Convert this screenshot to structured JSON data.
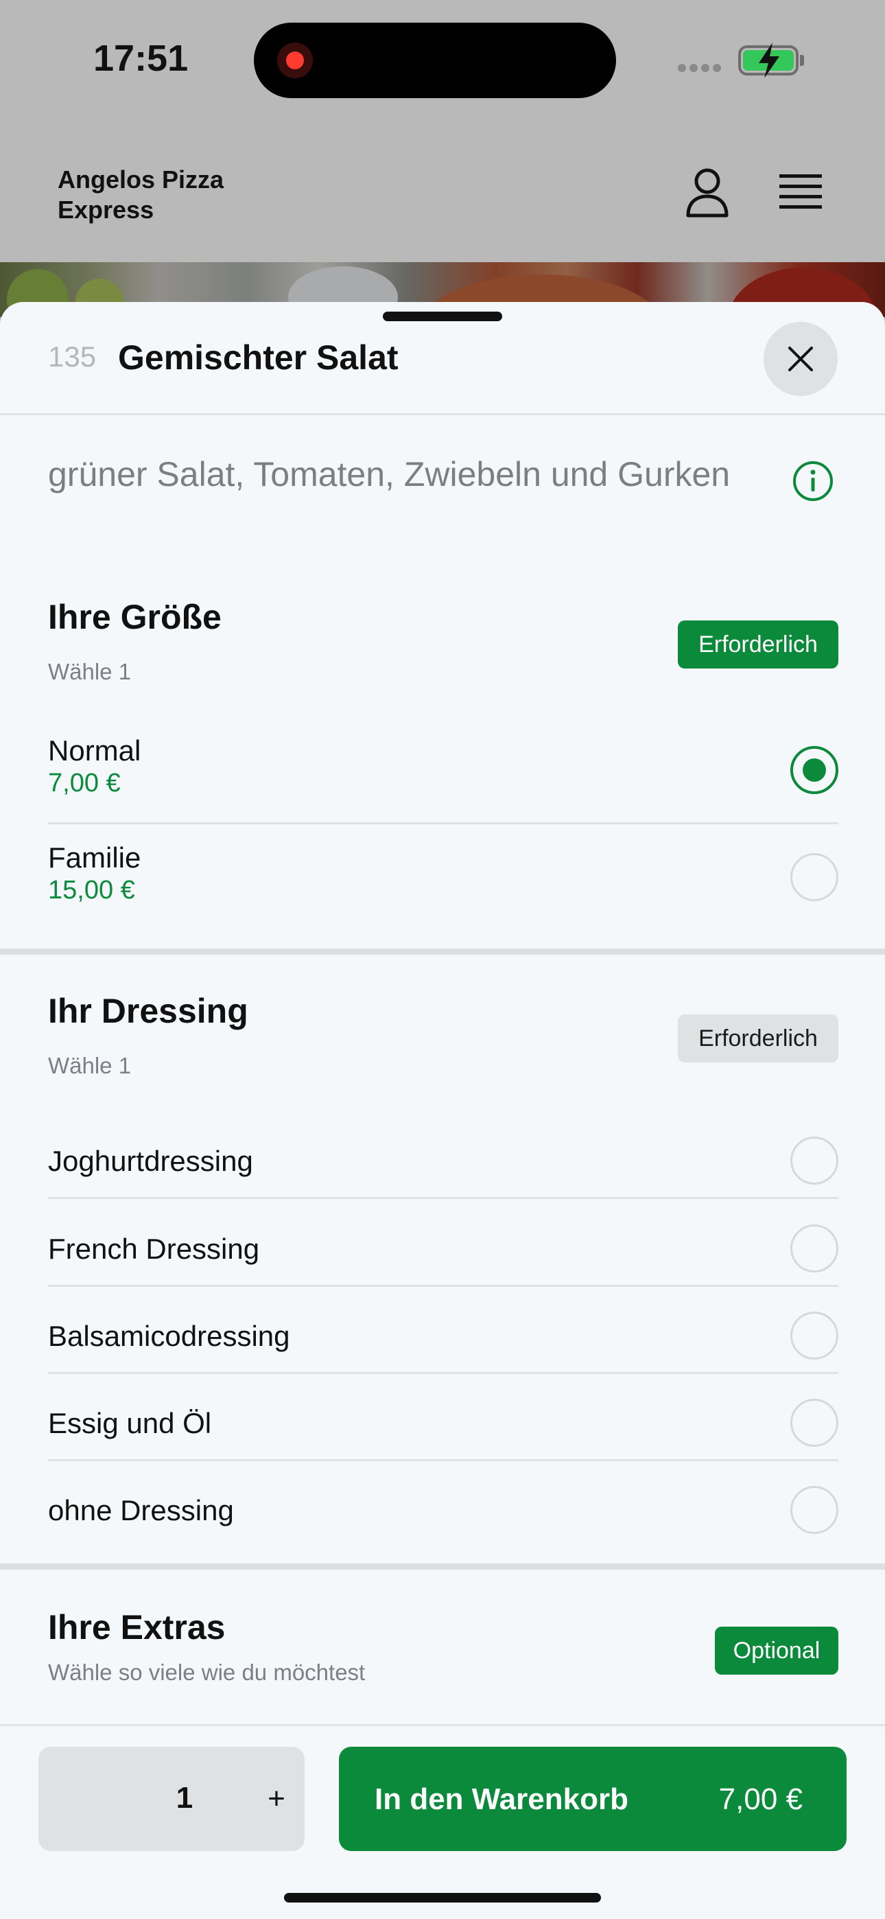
{
  "status_bar": {
    "time": "17:51"
  },
  "header": {
    "brand": "Angelos Pizza Express",
    "user_icon": "user-icon",
    "menu_icon": "hamburger-menu-icon"
  },
  "item": {
    "number": "135",
    "title": "Gemischter Salat",
    "description": "grüner Salat, Tomaten, Zwiebeln und Gurken"
  },
  "size_section": {
    "title": "Ihre Größe",
    "subtitle": "Wähle 1",
    "badge": "Erforderlich",
    "options": [
      {
        "label": "Normal",
        "price": "7,00 €",
        "selected": true
      },
      {
        "label": "Familie",
        "price": "15,00 €",
        "selected": false
      }
    ]
  },
  "dressing_section": {
    "title": "Ihr Dressing",
    "subtitle": "Wähle 1",
    "badge": "Erforderlich",
    "options": [
      {
        "label": "Joghurtdressing",
        "selected": false
      },
      {
        "label": "French Dressing",
        "selected": false
      },
      {
        "label": "Balsamicodressing",
        "selected": false
      },
      {
        "label": "Essig und Öl",
        "selected": false
      },
      {
        "label": "ohne Dressing",
        "selected": false
      }
    ]
  },
  "extras_section": {
    "title": "Ihre Extras",
    "subtitle": "Wähle so viele wie du möchtest",
    "badge": "Optional"
  },
  "action_bar": {
    "quantity": "1",
    "plus": "+",
    "cart_label": "In den Warenkorb",
    "cart_price": "7,00 €"
  },
  "colors": {
    "accent": "#0a8a3a",
    "sheet_background": "#f5f8fa",
    "backdrop": "#b9b9b9"
  }
}
